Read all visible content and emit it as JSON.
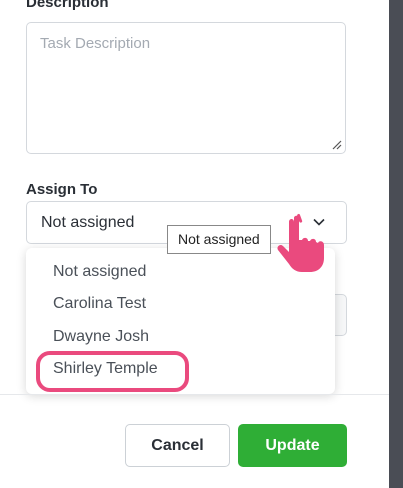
{
  "description": {
    "label": "Description",
    "placeholder": "Task Description"
  },
  "assign_to": {
    "label": "Assign To",
    "selected": "Not assigned",
    "tooltip": "Not assigned",
    "options": [
      "Not assigned",
      "Carolina Test",
      "Dwayne Josh",
      "Shirley Temple"
    ],
    "highlighted_option": "Shirley Temple"
  },
  "footer": {
    "cancel_label": "Cancel",
    "update_label": "Update"
  },
  "colors": {
    "accent_green": "#2fae36",
    "highlight_pink": "#ea4a7e"
  },
  "icons": {
    "dropdown": "chevron-down-icon",
    "cursor": "hand-pointer-icon",
    "resize": "resize-grip-icon"
  }
}
